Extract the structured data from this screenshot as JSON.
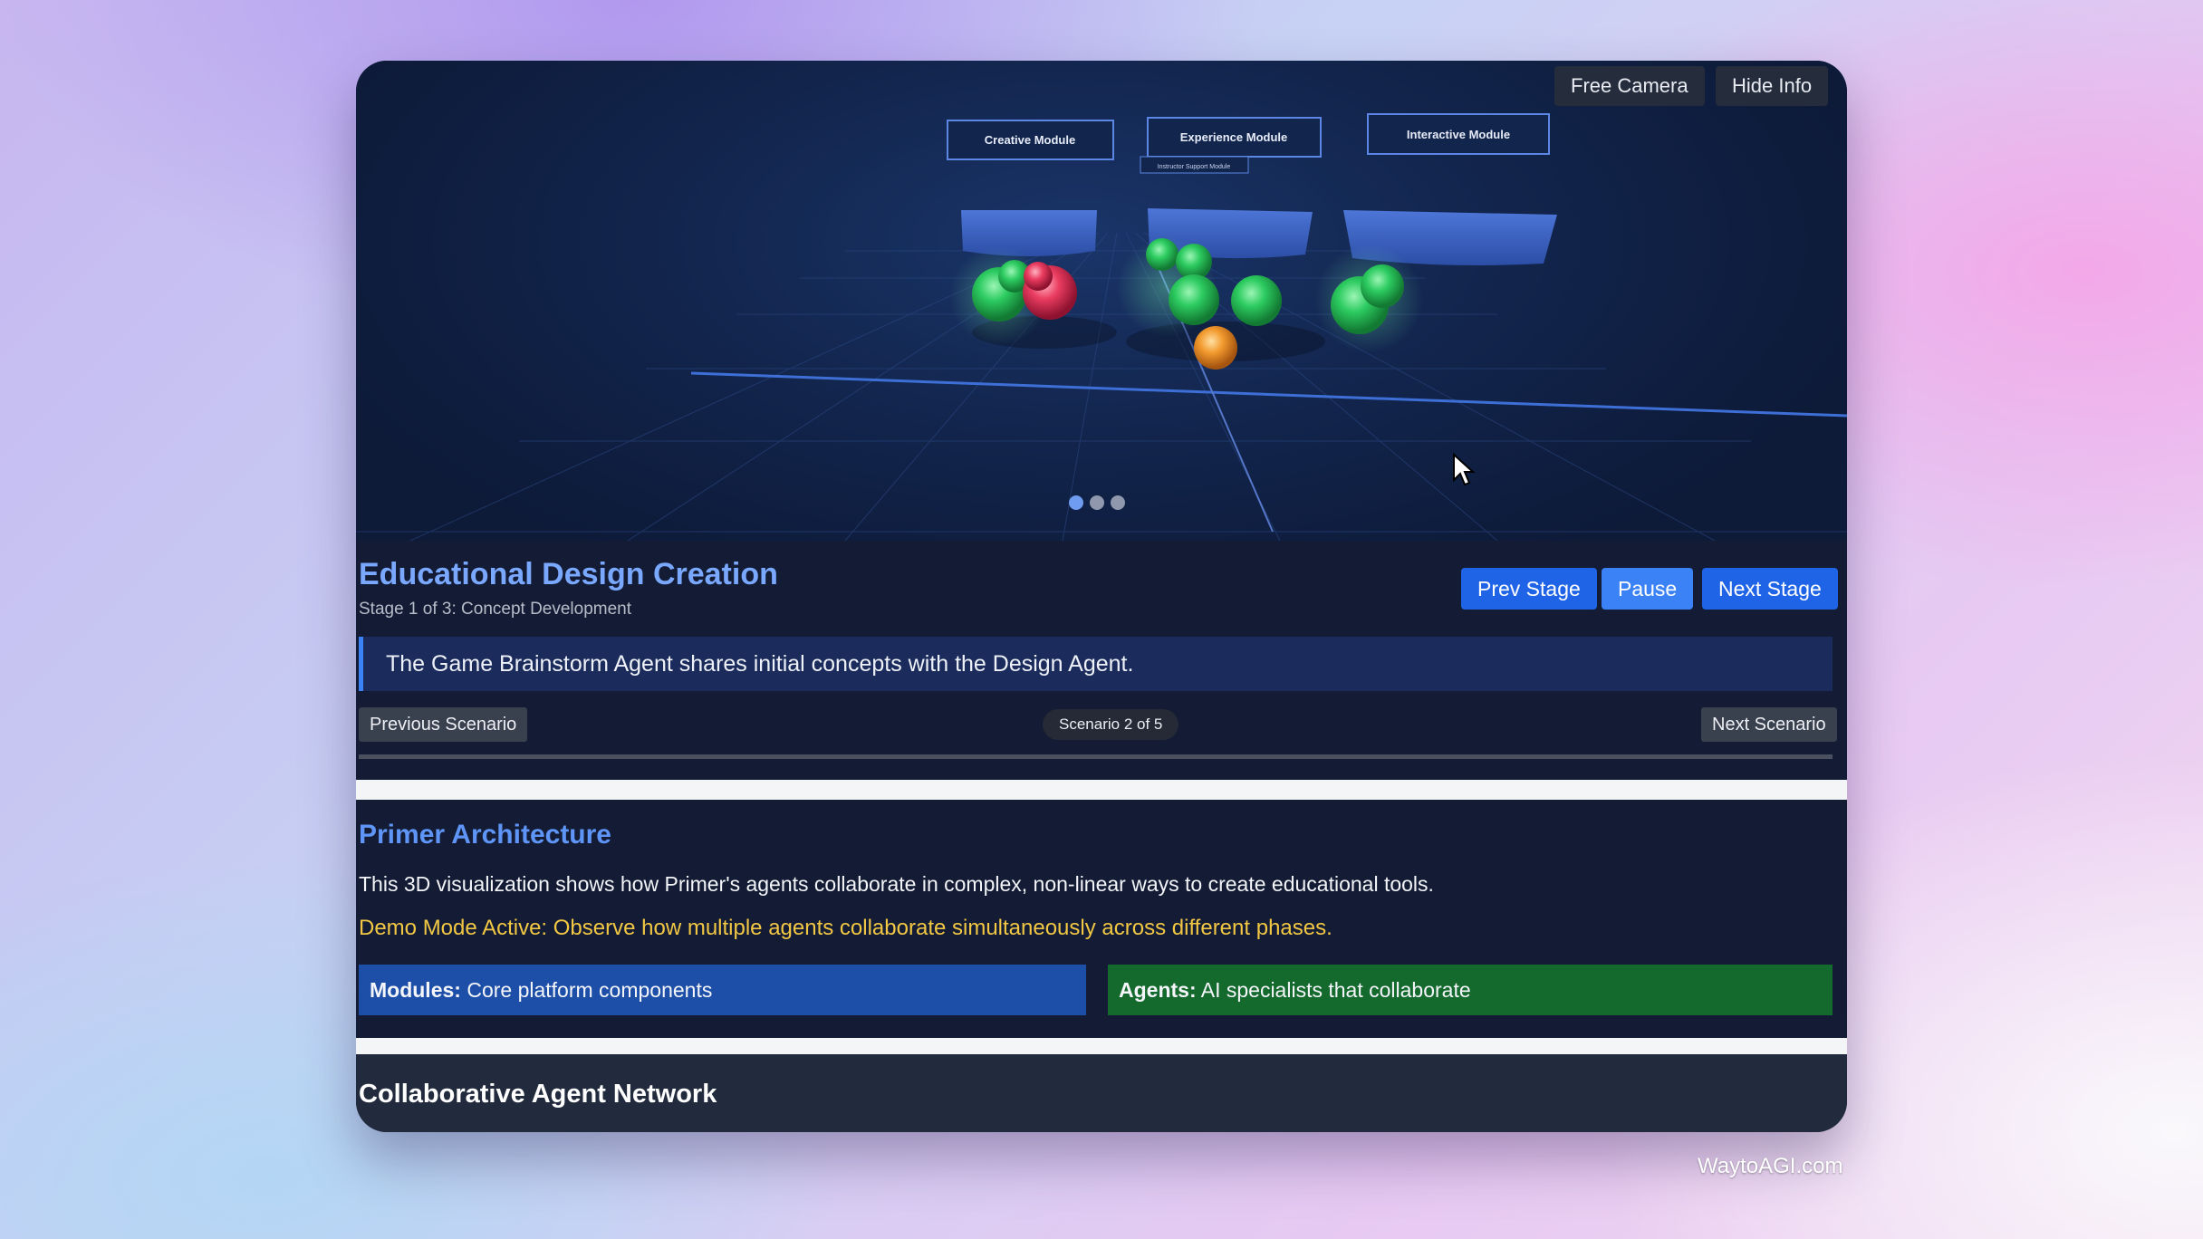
{
  "camera": {
    "free_camera": "Free Camera",
    "hide_info": "Hide Info"
  },
  "scene": {
    "modules": [
      "Creative Module",
      "Experience Module",
      "Interactive Module"
    ],
    "sub_module_label": "Instructor Support Module",
    "stage_dots": 3,
    "active_dot": 1,
    "colors": {
      "agent_green": "#28c25a",
      "agent_red": "#e8365a",
      "agent_orange": "#f29a2e",
      "module_block": "#3c63c9"
    }
  },
  "stage": {
    "title": "Educational Design Creation",
    "subtitle": "Stage 1 of 3: Concept Development",
    "prev": "Prev Stage",
    "pause": "Pause",
    "next": "Next Stage"
  },
  "narration": "The Game Brainstorm Agent shares initial concepts with the Design Agent.",
  "scenario": {
    "previous": "Previous Scenario",
    "counter": "Scenario 2 of 5",
    "next": "Next Scenario"
  },
  "architecture": {
    "title": "Primer Architecture",
    "description": "This 3D visualization shows how Primer's agents collaborate in complex, non-linear ways to create educational tools.",
    "demo": "Demo Mode Active: Observe how multiple agents collaborate simultaneously across different phases.",
    "modules_label": "Modules:",
    "modules_text": " Core platform components",
    "agents_label": "Agents:",
    "agents_text": " AI specialists that collaborate"
  },
  "network": {
    "title": "Collaborative Agent Network"
  },
  "watermark": "WaytoAGI.com"
}
